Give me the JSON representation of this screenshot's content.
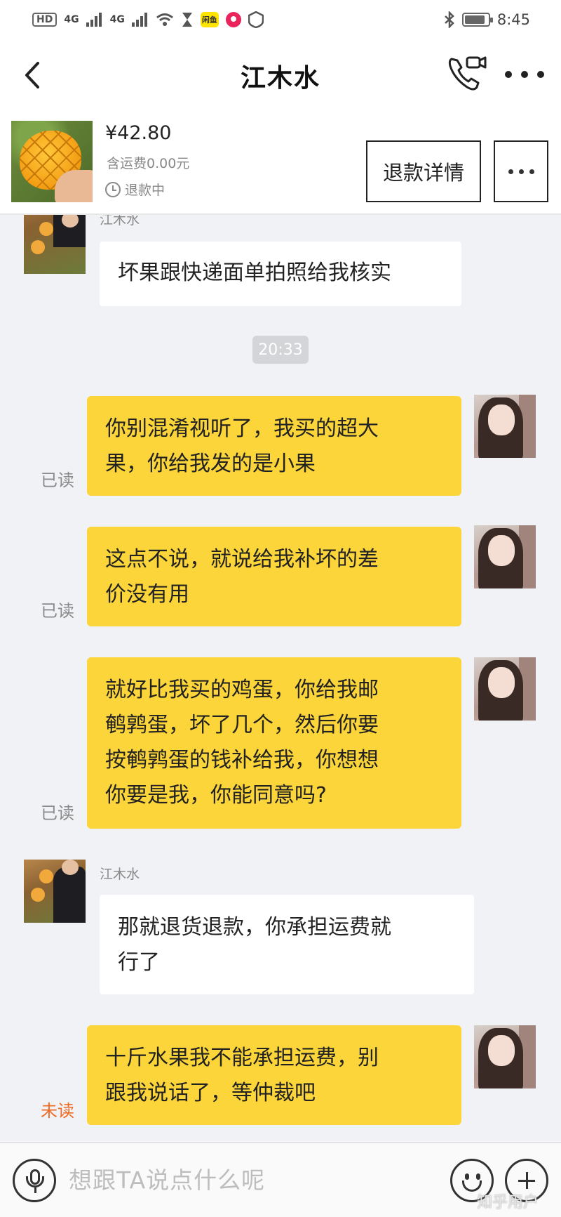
{
  "status_bar": {
    "left_badges": [
      "HD",
      "4G",
      "4G"
    ],
    "apps": [
      "闲鱼"
    ],
    "time": "8:45",
    "battery_level": 0.9
  },
  "nav": {
    "title": "江木水"
  },
  "product": {
    "price": "¥42.80",
    "shipping": "含运费0.00元",
    "status": "退款中",
    "refund_button": "退款详情"
  },
  "chat": {
    "seller_name": "江木水",
    "time_divider": "20:33",
    "messages": [
      {
        "side": "left",
        "text_lines": [
          "坏果跟快递面单拍照给我核实"
        ]
      },
      {
        "side": "right",
        "text_lines": [
          "你别混淆视听了，我买的超大",
          "果，你给我发的是小果"
        ],
        "status": "已读"
      },
      {
        "side": "right",
        "text_lines": [
          "这点不说，就说给我补坏的差",
          "价没有用"
        ],
        "status": "已读"
      },
      {
        "side": "right",
        "text_lines": [
          "就好比我买的鸡蛋，你给我邮",
          "鹌鹑蛋，坏了几个，然后你要",
          "按鹌鹑蛋的钱补给我，你想想",
          "你要是我，你能同意吗?"
        ],
        "status": "已读"
      },
      {
        "side": "left",
        "text_lines": [
          "那就退货退款，你承担运费就",
          "行了"
        ]
      },
      {
        "side": "right",
        "text_lines": [
          "十斤水果我不能承担运费，别",
          "跟我说话了，等仲裁吧"
        ],
        "status": "未读"
      }
    ]
  },
  "input": {
    "placeholder": "想跟TA说点什么呢",
    "watermark": "知乎用户"
  }
}
